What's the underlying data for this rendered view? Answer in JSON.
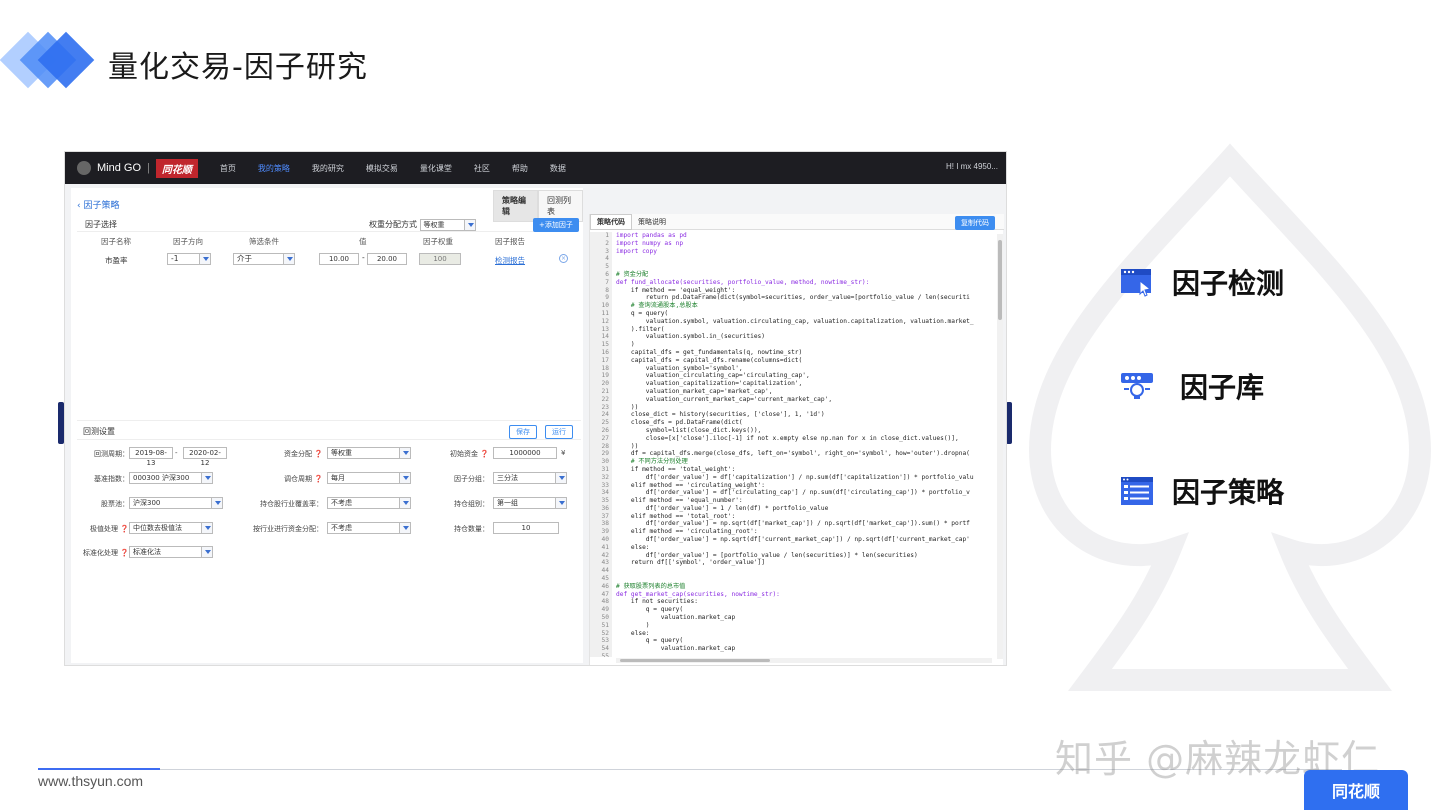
{
  "slide": {
    "title": "量化交易-因子研究",
    "footer_url": "www.thsyun.com",
    "watermark": "知乎 @麻辣龙虾仁",
    "badge": "同花顺"
  },
  "app": {
    "brand": "Mind GO",
    "brand_partner": "同花顺",
    "nav": [
      "首页",
      "我的策略",
      "我的研究",
      "模拟交易",
      "量化课堂",
      "社区",
      "帮助",
      "数据"
    ],
    "nav_active": "我的策略",
    "user": "H! I mx 4950..."
  },
  "left": {
    "back_label": "因子策略",
    "top_tabs": [
      "策略编辑",
      "回测列表"
    ],
    "factor_select_label": "因子选择",
    "weight_method_label": "权重分配方式",
    "weight_method_value": "等权重",
    "add_factor": "+添加因子",
    "columns": [
      "因子名称",
      "因子方向",
      "筛选条件",
      "值",
      "因子权重",
      "因子报告"
    ],
    "row": {
      "name": "市盈率",
      "direction": "-1",
      "condition": "介于",
      "min": "10.00",
      "max": "20.00",
      "weight": "100",
      "report": "检测报告"
    },
    "backtest": {
      "title": "回测设置",
      "save": "保存",
      "run": "运行",
      "period_label": "回测周期：",
      "start": "2019-08-13",
      "end": "2020-02-12",
      "capital_alloc_label": "资金分配",
      "capital_alloc": "等权重",
      "init_cap_label": "初始资金",
      "init_cap": "1000000",
      "currency": "¥",
      "benchmark_label": "基准指数：",
      "benchmark": "000300 沪深300",
      "rebalance_label": "调仓周期",
      "rebalance": "每月",
      "group_label": "因子分组：",
      "group": "三分法",
      "pool_label": "股票池：",
      "pool": "沪深300",
      "industry_label": "持仓股行业覆盖率：",
      "industry": "不考虑",
      "hold_group_label": "持仓组别：",
      "hold_group": "第一组",
      "extreme_label": "极值处理",
      "extreme": "中位数去极值法",
      "ind_cap_label": "按行业进行资金分配：",
      "ind_cap": "不考虑",
      "hold_num_label": "持仓数量：",
      "hold_num": "10",
      "std_label": "标准化处理",
      "std": "标准化法"
    }
  },
  "code": {
    "tabs": [
      "策略代码",
      "策略说明"
    ],
    "copy": "复制代码",
    "line_numbers": [
      "1",
      "2",
      "3",
      "4",
      "5",
      "6",
      "7",
      "8",
      "9",
      "10",
      "11",
      "12",
      "13",
      "14",
      "15",
      "16",
      "17",
      "18",
      "19",
      "20",
      "21",
      "22",
      "23",
      "24",
      "25",
      "26",
      "27",
      "28",
      "29",
      "30",
      "31",
      "32",
      "33",
      "34",
      "35",
      "36",
      "37",
      "38",
      "39",
      "40",
      "41",
      "42",
      "43",
      "44",
      "45",
      "46",
      "47",
      "48",
      "49",
      "50",
      "51",
      "52",
      "53",
      "54",
      "55"
    ],
    "lines": [
      "import pandas as pd",
      "import numpy as np",
      "import copy",
      "",
      "",
      "# 资金分配",
      "def fund_allocate(securities, portfolio_value, method, nowtime_str):",
      "    if method == 'equal_weight':",
      "        return pd.DataFrame(dict(symbol=securities, order_value=[portfolio_value / len(securiti",
      "    # 查询流通股本,总股本",
      "    q = query(",
      "        valuation.symbol, valuation.circulating_cap, valuation.capitalization, valuation.market_",
      "    ).filter(",
      "        valuation.symbol.in_(securities)",
      "    )",
      "    capital_dfs = get_fundamentals(q, nowtime_str)",
      "    capital_dfs = capital_dfs.rename(columns=dict(",
      "        valuation_symbol='symbol',",
      "        valuation_circulating_cap='circulating_cap',",
      "        valuation_capitalization='capitalization',",
      "        valuation_market_cap='market_cap',",
      "        valuation_current_market_cap='current_market_cap',",
      "    ))",
      "    close_dict = history(securities, ['close'], 1, '1d')",
      "    close_dfs = pd.DataFrame(dict(",
      "        symbol=list(close_dict.keys()),",
      "        close=[x['close'].iloc[-1] if not x.empty else np.nan for x in close_dict.values()],",
      "    ))",
      "    df = capital_dfs.merge(close_dfs, left_on='symbol', right_on='symbol', how='outer').dropna(",
      "    # 不同方法分别处理",
      "    if method == 'total_weight':",
      "        df['order_value'] = df['capitalization'] / np.sum(df['capitalization']) * portfolio_valu",
      "    elif method == 'circulating_weight':",
      "        df['order_value'] = df['circulating_cap'] / np.sum(df['circulating_cap']) * portfolio_v",
      "    elif method == 'equal_number':",
      "        df['order_value'] = 1 / len(df) * portfolio_value",
      "    elif method == 'total_root':",
      "        df['order_value'] = np.sqrt(df['market_cap']) / np.sqrt(df['market_cap']).sum() * portf",
      "    elif method == 'circulating_root':",
      "        df['order_value'] = np.sqrt(df['current_market_cap']) / np.sqrt(df['current_market_cap'",
      "    else:",
      "        df['order_value'] = [portfolio_value / len(securities)] * len(securities)",
      "    return df[['symbol', 'order_value']]",
      "",
      "",
      "# 获取股票列表的总市值",
      "def get_market_cap(securities, nowtime_str):",
      "    if not securities:",
      "        q = query(",
      "            valuation.market_cap",
      "        )",
      "    else:",
      "        q = query(",
      "            valuation.market_cap"
    ]
  },
  "features": [
    {
      "label": "因子检测",
      "icon": "window-cursor-icon"
    },
    {
      "label": "因子库",
      "icon": "database-bulb-icon"
    },
    {
      "label": "因子策略",
      "icon": "document-list-icon"
    }
  ],
  "colors": {
    "accent": "#2f6ff0",
    "nav_bg": "#1d1d22",
    "nav_active": "#4f8cff"
  }
}
